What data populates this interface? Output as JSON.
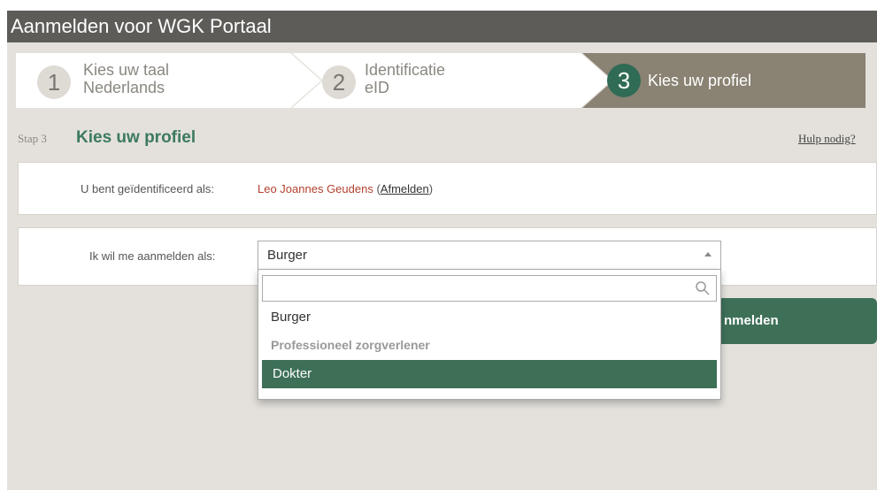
{
  "window": {
    "title": "Aanmelden voor WGK Portaal"
  },
  "steps": [
    {
      "number": "1",
      "title": "Kies uw taal",
      "subtitle": "Nederlands"
    },
    {
      "number": "2",
      "title": "Identificatie",
      "subtitle": "eID"
    },
    {
      "number": "3",
      "title": "Kies uw profiel"
    }
  ],
  "page": {
    "step_label": "Stap 3",
    "step_title": "Kies uw profiel",
    "help_link": "Hulp nodig?"
  },
  "identification": {
    "label": "U bent geïdentificeerd als:",
    "name": "Leo Joannes Geudens",
    "open_paren": "(",
    "logout_link": "Afmelden",
    "close_paren": ")"
  },
  "profile_select": {
    "label": "Ik wil me aanmelden als:",
    "value": "Burger",
    "search_placeholder": "",
    "options": [
      {
        "label": "Burger"
      },
      {
        "group": "Professioneel zorgverlener"
      },
      {
        "label": "Dokter",
        "highlighted": true
      }
    ]
  },
  "login_button": {
    "label": "nmelden"
  },
  "colors": {
    "brand_green": "#3e7058",
    "title_bar": "#5d5c58",
    "active_step": "#8a8273",
    "name_red": "#b3402e"
  }
}
